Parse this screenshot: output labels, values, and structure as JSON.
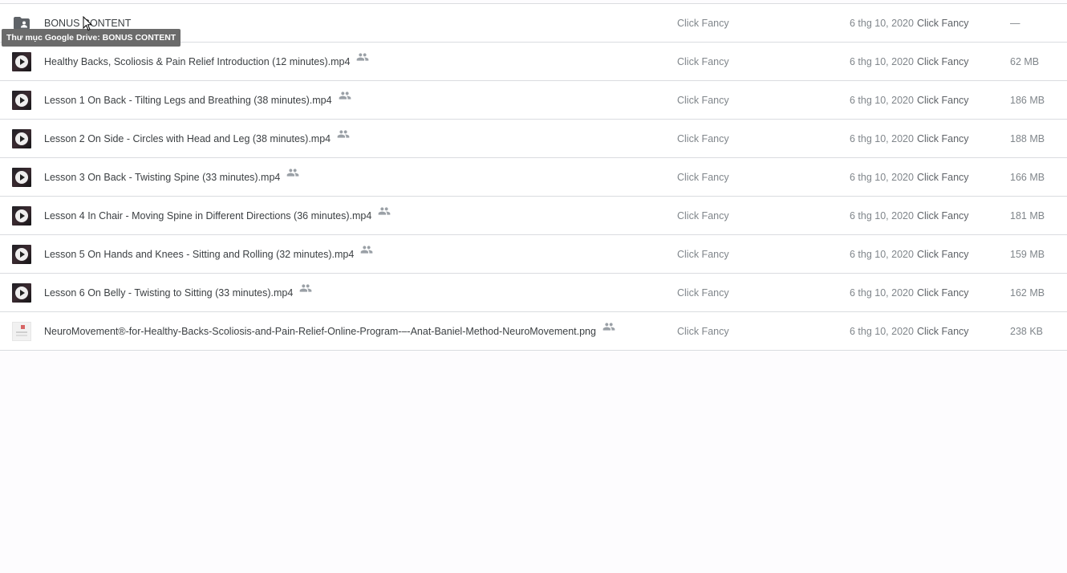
{
  "tooltip": "Thư mục Google Drive: BONUS CONTENT",
  "rows": [
    {
      "type": "folder",
      "name": "BONUS CONTENT",
      "shared": false,
      "owner": "Click Fancy",
      "date": "6 thg 10, 2020",
      "modified_by": "Click Fancy",
      "size": "—"
    },
    {
      "type": "video",
      "name": "Healthy Backs, Scoliosis & Pain Relief Introduction (12 minutes).mp4",
      "shared": true,
      "owner": "Click Fancy",
      "date": "6 thg 10, 2020",
      "modified_by": "Click Fancy",
      "size": "62 MB"
    },
    {
      "type": "video",
      "name": "Lesson 1 On Back - Tilting Legs and Breathing (38 minutes).mp4",
      "shared": true,
      "owner": "Click Fancy",
      "date": "6 thg 10, 2020",
      "modified_by": "Click Fancy",
      "size": "186 MB"
    },
    {
      "type": "video",
      "name": "Lesson 2 On Side - Circles with Head and Leg (38 minutes).mp4",
      "shared": true,
      "owner": "Click Fancy",
      "date": "6 thg 10, 2020",
      "modified_by": "Click Fancy",
      "size": "188 MB"
    },
    {
      "type": "video",
      "name": "Lesson 3 On Back - Twisting Spine (33 minutes).mp4",
      "shared": true,
      "owner": "Click Fancy",
      "date": "6 thg 10, 2020",
      "modified_by": "Click Fancy",
      "size": "166 MB"
    },
    {
      "type": "video",
      "name": "Lesson 4 In Chair - Moving Spine in Different Directions (36 minutes).mp4",
      "shared": true,
      "owner": "Click Fancy",
      "date": "6 thg 10, 2020",
      "modified_by": "Click Fancy",
      "size": "181 MB"
    },
    {
      "type": "video",
      "name": "Lesson 5 On Hands and Knees - Sitting and Rolling (32 minutes).mp4",
      "shared": true,
      "owner": "Click Fancy",
      "date": "6 thg 10, 2020",
      "modified_by": "Click Fancy",
      "size": "159 MB"
    },
    {
      "type": "video",
      "name": "Lesson 6 On Belly - Twisting to Sitting (33 minutes).mp4",
      "shared": true,
      "owner": "Click Fancy",
      "date": "6 thg 10, 2020",
      "modified_by": "Click Fancy",
      "size": "162 MB"
    },
    {
      "type": "image",
      "name": "NeuroMovement®-for-Healthy-Backs-Scoliosis-and-Pain-Relief-Online-Program-–-Anat-Baniel-Method-NeuroMovement.png",
      "shared": true,
      "owner": "Click Fancy",
      "date": "6 thg 10, 2020",
      "modified_by": "Click Fancy",
      "size": "238 KB"
    }
  ]
}
